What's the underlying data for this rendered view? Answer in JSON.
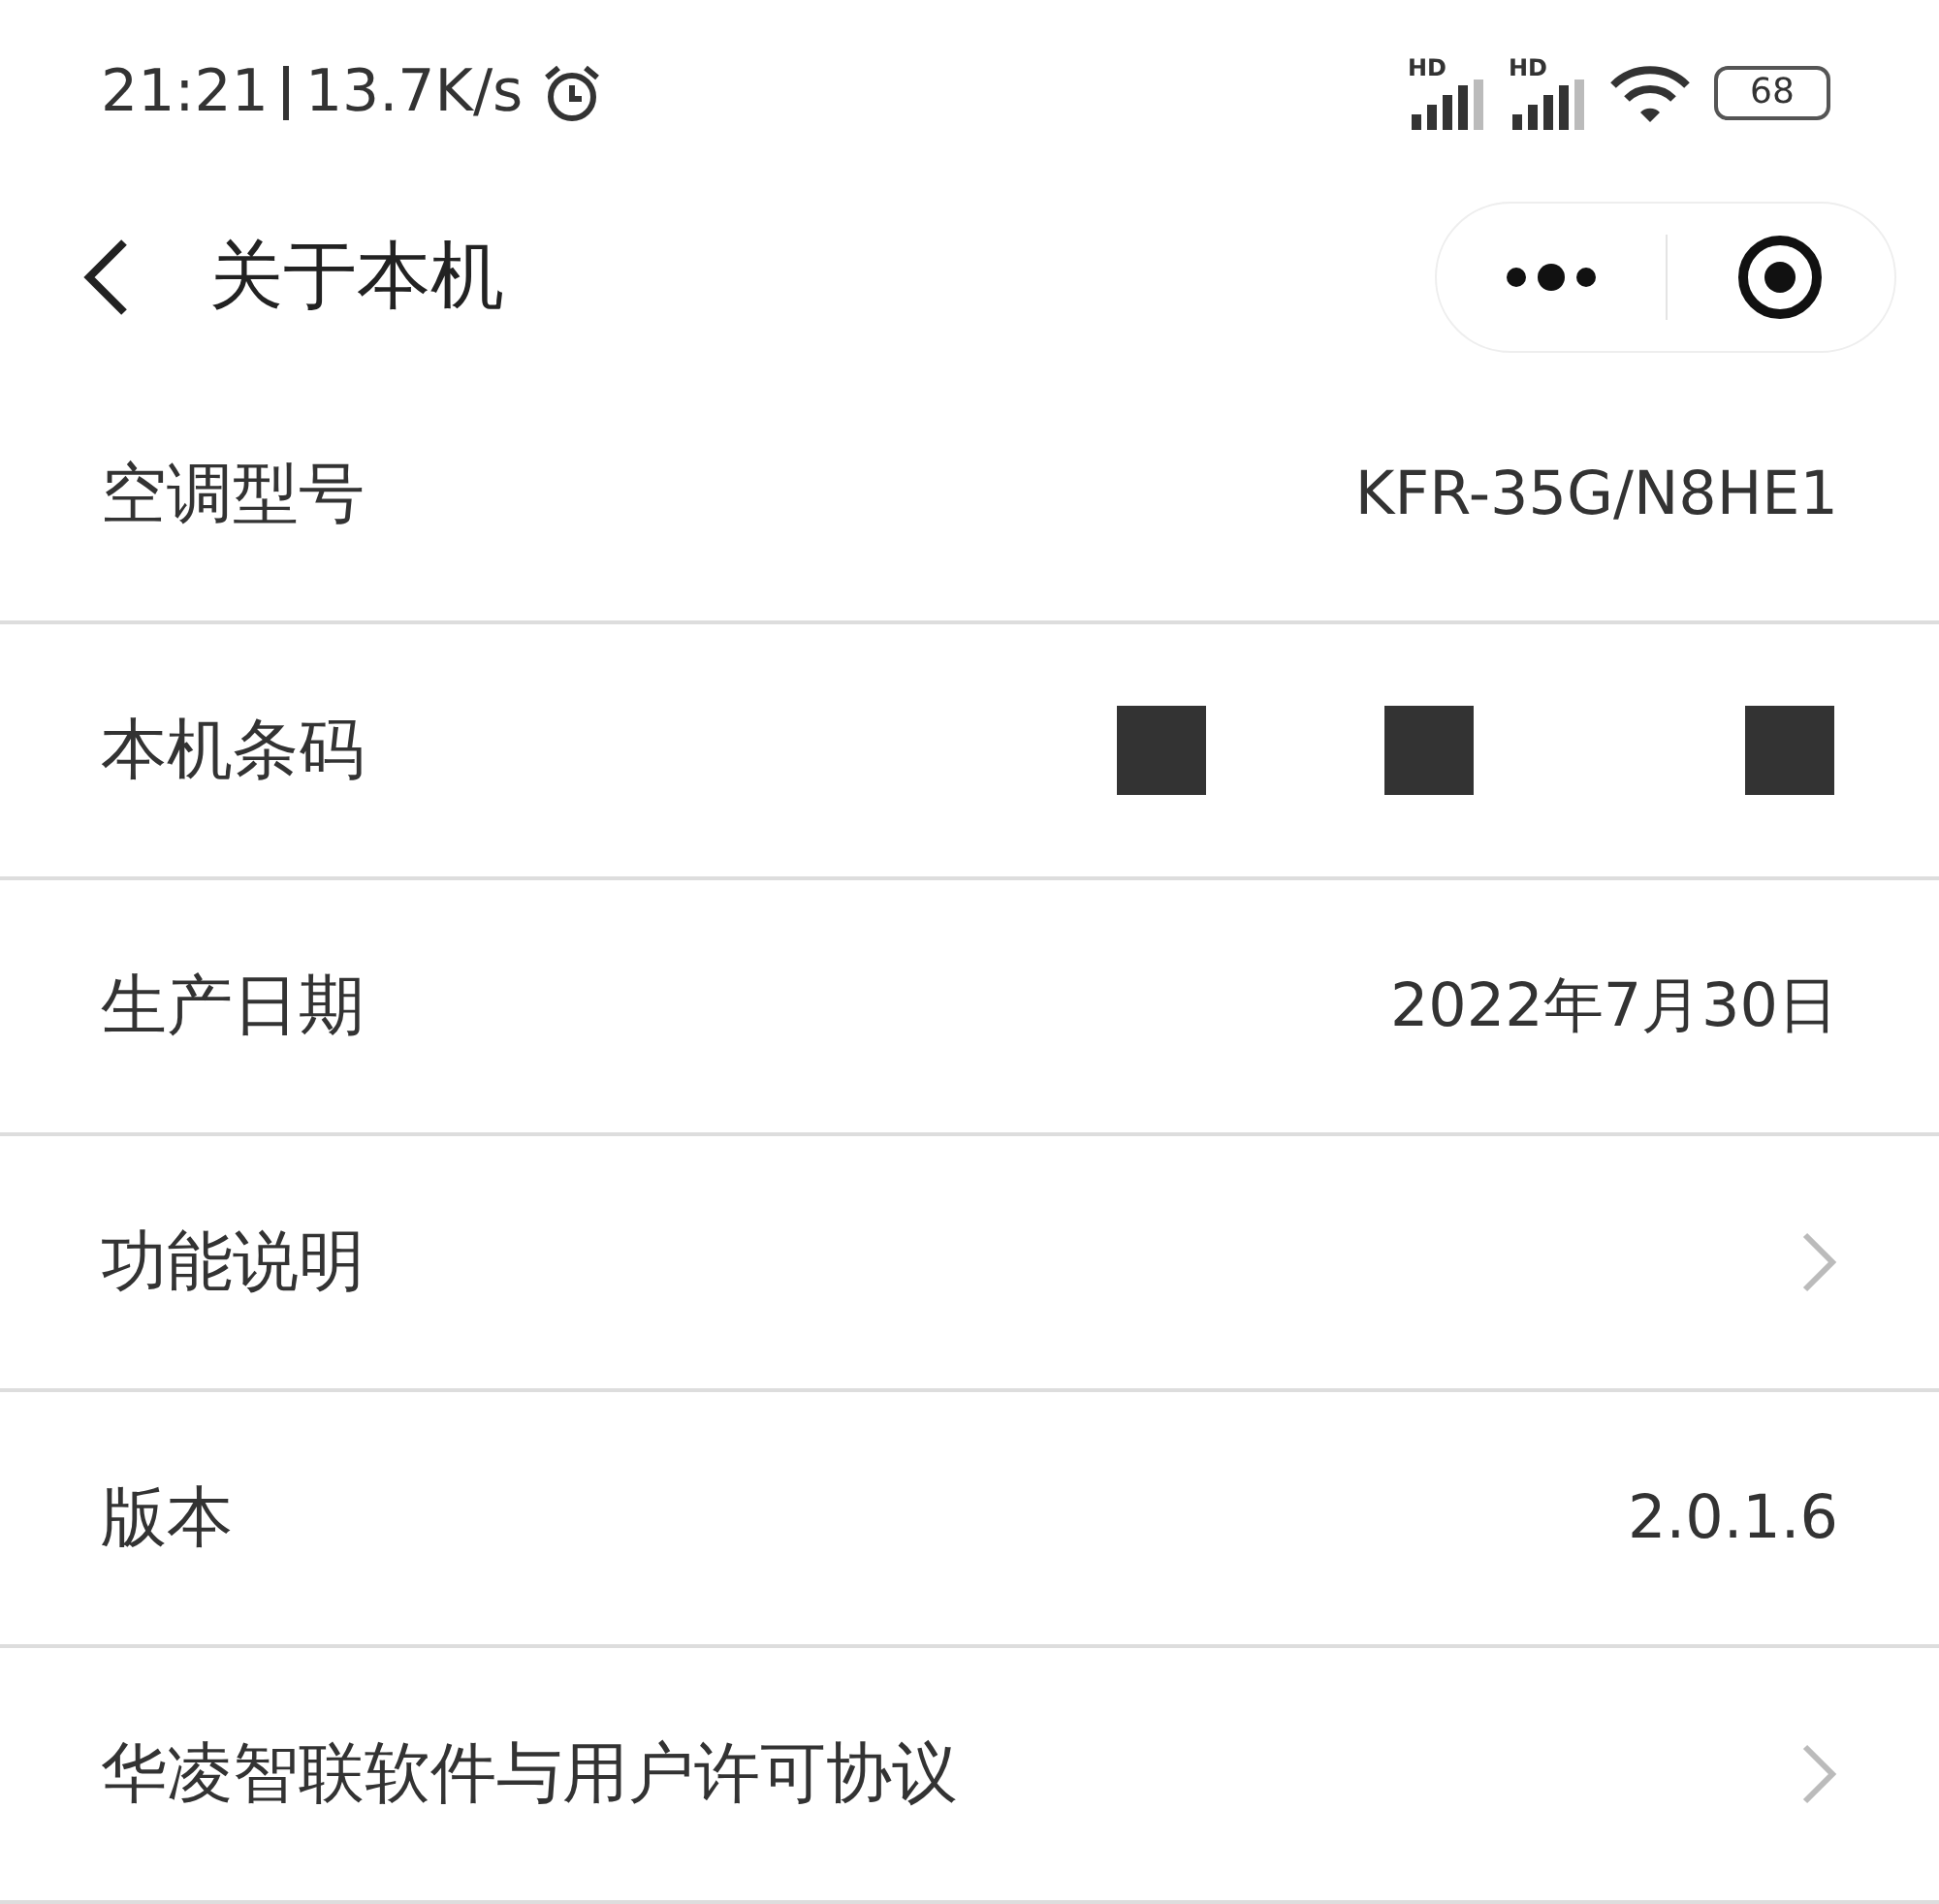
{
  "status_bar": {
    "time": "21:21",
    "speed": "13.7K/s",
    "signals": [
      {
        "label": "HD"
      },
      {
        "label": "HD"
      }
    ],
    "battery": "68"
  },
  "nav": {
    "title": "关于本机"
  },
  "rows": [
    {
      "kind": "value",
      "label": "空调型号",
      "value": "KFR-35G/N8HE1"
    },
    {
      "kind": "redacted",
      "label": "本机条码"
    },
    {
      "kind": "value",
      "label": "生产日期",
      "value": "2022年7月30日"
    },
    {
      "kind": "link",
      "label": "功能说明"
    },
    {
      "kind": "value",
      "label": "版本",
      "value": "2.0.1.6"
    },
    {
      "kind": "link",
      "label": "华凌智联软件与用户许可协议"
    }
  ]
}
